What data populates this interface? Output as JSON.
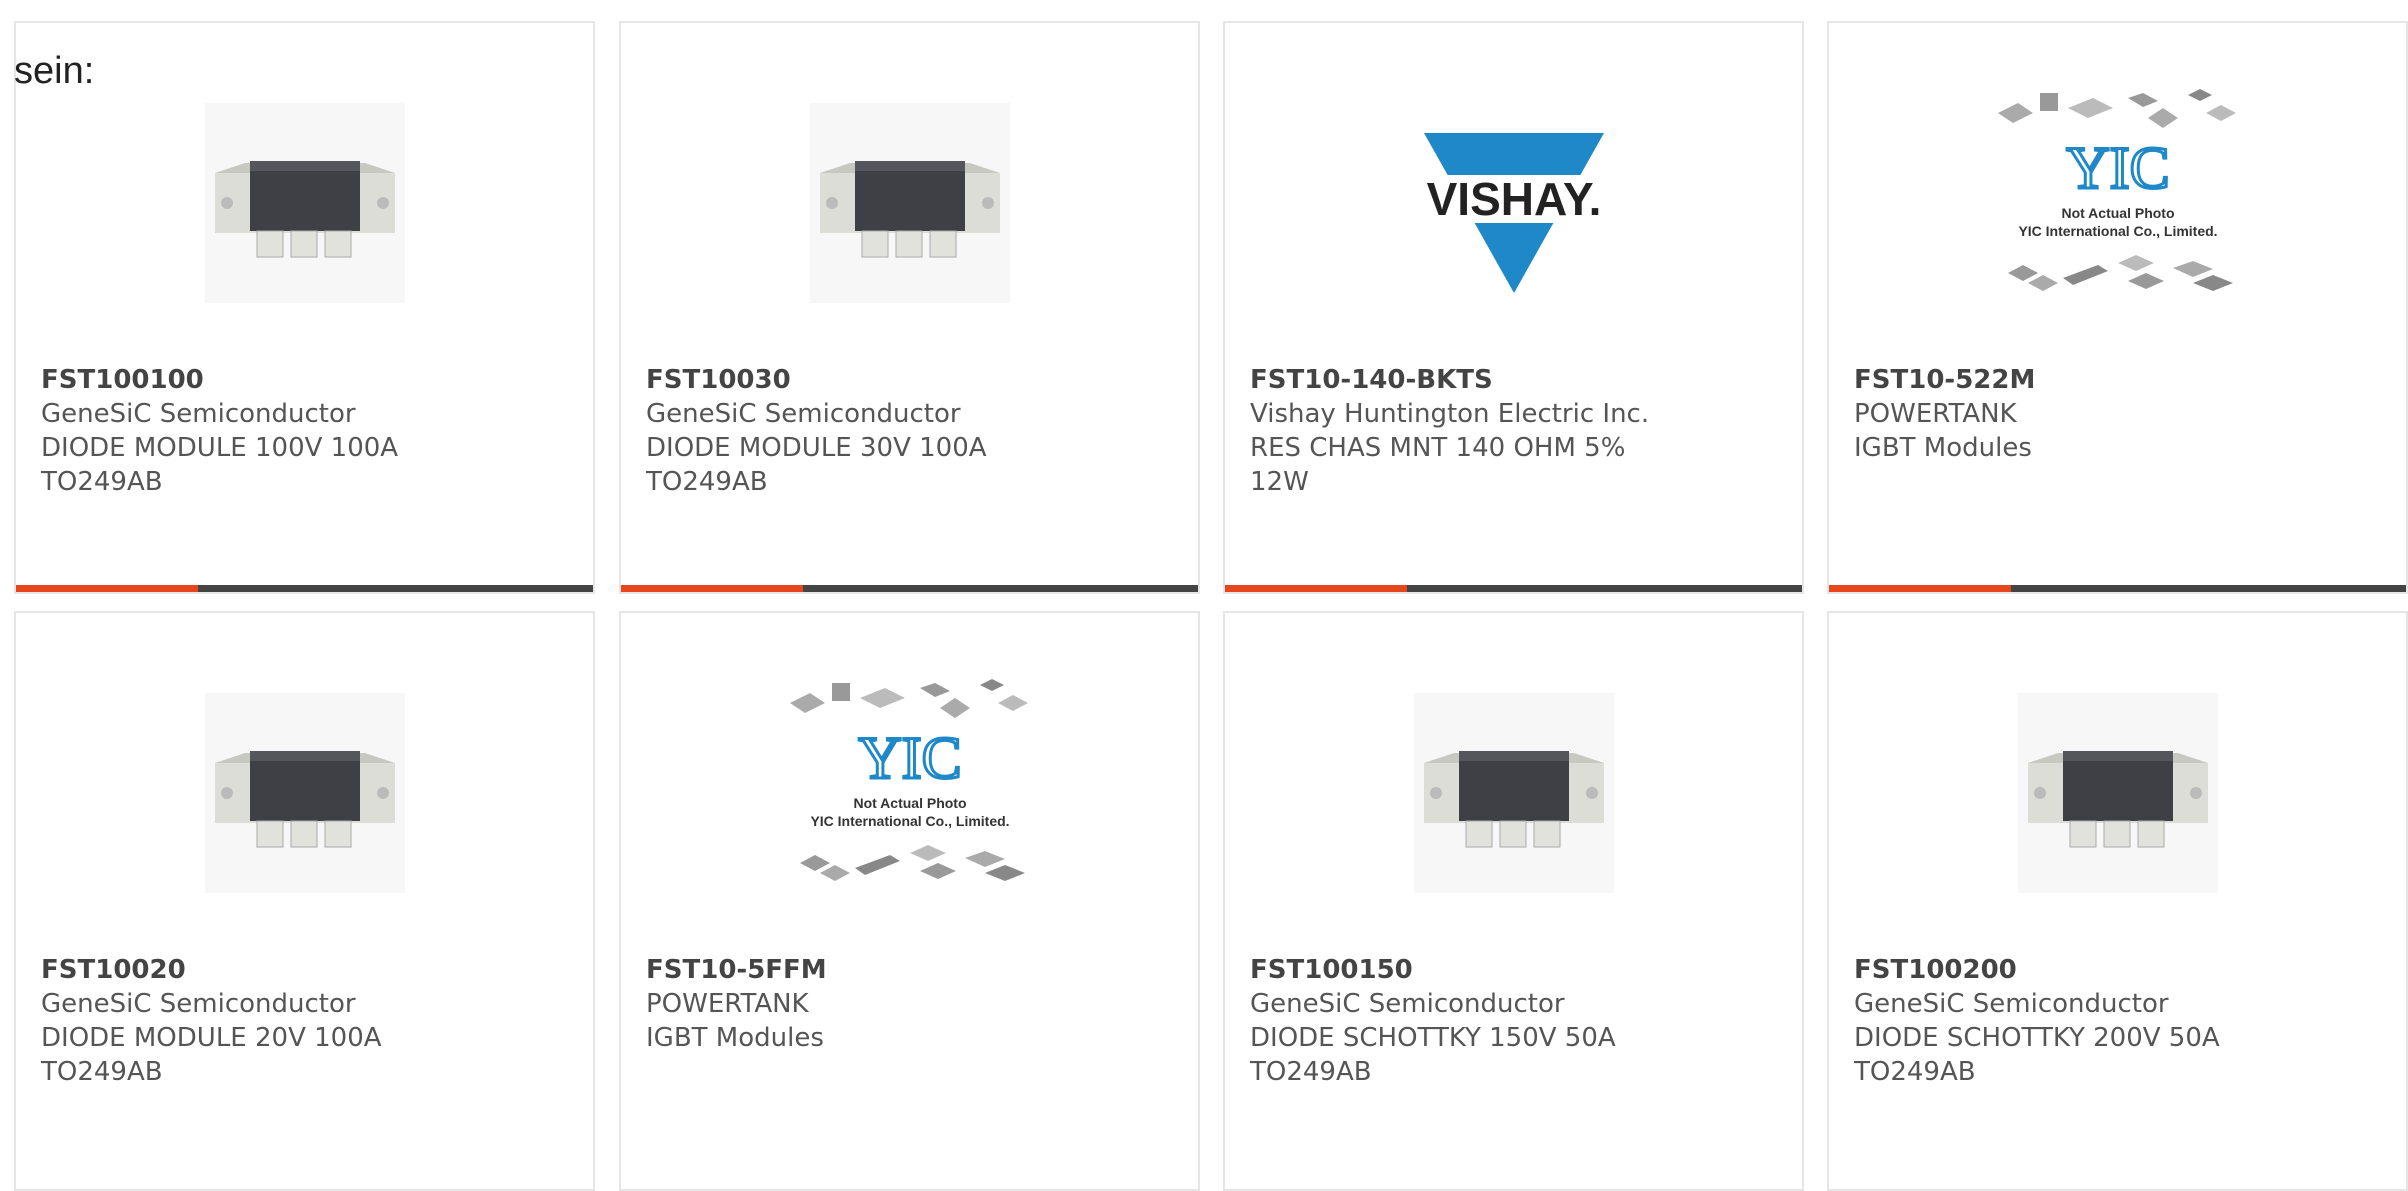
{
  "intro": "sein:",
  "accent_color": "#e8451c",
  "bar_color": "#444444",
  "products": [
    {
      "pn": "FST100100",
      "mfr": "GeneSiC Semiconductor",
      "desc": "DIODE MODULE 100V 100A TO249AB",
      "image": "diode-module-icon"
    },
    {
      "pn": "FST10030",
      "mfr": "GeneSiC Semiconductor",
      "desc": "DIODE MODULE 30V 100A TO249AB",
      "image": "diode-module-icon"
    },
    {
      "pn": "FST10-140-BKTS",
      "mfr": "Vishay Huntington Electric Inc.",
      "desc": "RES CHAS MNT 140 OHM 5% 12W",
      "image": "vishay-logo",
      "logo_text": "VISHAY."
    },
    {
      "pn": "FST10-522M",
      "mfr": "POWERTANK",
      "desc": "IGBT Modules",
      "image": "yic-placeholder",
      "placeholder_line1": "Not Actual Photo",
      "placeholder_line2": "YIC International Co., Limited."
    },
    {
      "pn": "FST10020",
      "mfr": "GeneSiC Semiconductor",
      "desc": "DIODE MODULE 20V 100A TO249AB",
      "image": "diode-module-icon"
    },
    {
      "pn": "FST10-5FFM",
      "mfr": "POWERTANK",
      "desc": "IGBT Modules",
      "image": "yic-placeholder",
      "placeholder_line1": "Not Actual Photo",
      "placeholder_line2": "YIC International Co., Limited."
    },
    {
      "pn": "FST100150",
      "mfr": "GeneSiC Semiconductor",
      "desc": "DIODE SCHOTTKY 150V 50A TO249AB",
      "image": "diode-module-icon"
    },
    {
      "pn": "FST100200",
      "mfr": "GeneSiC Semiconductor",
      "desc": "DIODE SCHOTTKY 200V 50A TO249AB",
      "image": "diode-module-icon"
    }
  ]
}
